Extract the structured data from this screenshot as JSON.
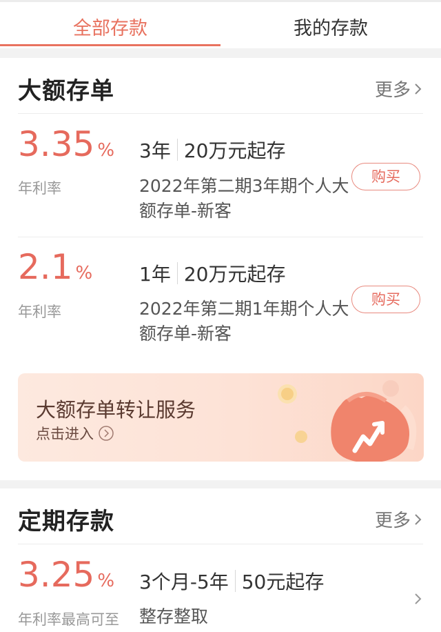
{
  "tabs": [
    {
      "label": "全部存款",
      "active": true
    },
    {
      "label": "我的存款",
      "active": false
    }
  ],
  "large_deposit": {
    "title": "大额存单",
    "more_label": "更多",
    "products": [
      {
        "rate": "3.35",
        "unit": "%",
        "rate_label": "年利率",
        "term": "3年",
        "min_amount": "20万元起存",
        "name": "2022年第二期3年期个人大额存单-新客",
        "buy_label": "购买"
      },
      {
        "rate": "2.1",
        "unit": "%",
        "rate_label": "年利率",
        "term": "1年",
        "min_amount": "20万元起存",
        "name": "2022年第二期1年期个人大额存单-新客",
        "buy_label": "购买"
      }
    ],
    "banner": {
      "title": "大额存单转让服务",
      "subtitle": "点击进入"
    }
  },
  "fixed_deposit": {
    "title": "定期存款",
    "more_label": "更多",
    "products": [
      {
        "rate": "3.25",
        "unit": "%",
        "rate_label": "年利率最高可至",
        "term": "3个月-5年",
        "min_amount": "50元起存",
        "name": "整存整取"
      }
    ]
  },
  "colors": {
    "accent": "#e8725f",
    "rate": "#e66a5d"
  }
}
